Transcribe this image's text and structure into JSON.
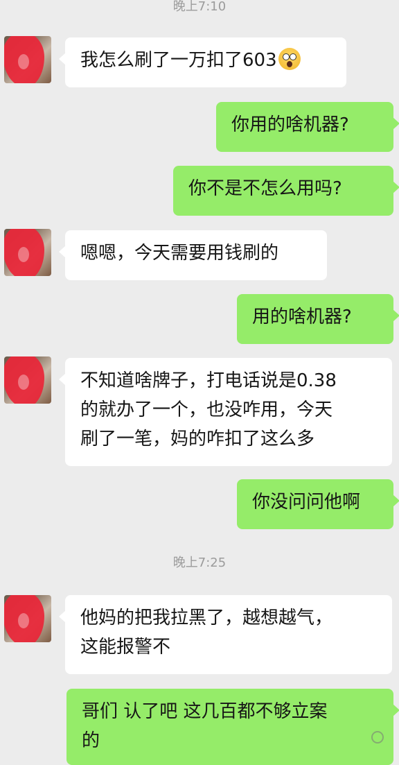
{
  "chat": {
    "timestamps": [
      "晚上7:10",
      "晚上7:25"
    ],
    "messages": [
      {
        "side": "in",
        "text": "我怎么刷了一万扣了603",
        "emoji": "shocked-face-icon"
      },
      {
        "side": "out",
        "text": "你用的啥机器?"
      },
      {
        "side": "out",
        "text": "你不是不怎么用吗?"
      },
      {
        "side": "in",
        "text": "嗯嗯，今天需要用钱刷的"
      },
      {
        "side": "out",
        "text": "用的啥机器?"
      },
      {
        "side": "in",
        "lines": [
          "不知道啥牌子，打电话说是0.38",
          "的就办了一个，也没咋用，今天",
          "刷了一笔，妈的咋扣了这么多"
        ]
      },
      {
        "side": "out",
        "text": "你没问问他啊"
      },
      {
        "side": "in",
        "lines": [
          "他妈的把我拉黑了，越想越气，",
          "这能报警不"
        ]
      },
      {
        "side": "out",
        "lines": [
          "哥们 认了吧 这几百都不够立案",
          "的"
        ]
      }
    ]
  },
  "colors": {
    "background": "#ececec",
    "incoming_bubble": "#ffffff",
    "outgoing_bubble": "#95ec69",
    "avatar_scribble": "#e8283a"
  }
}
